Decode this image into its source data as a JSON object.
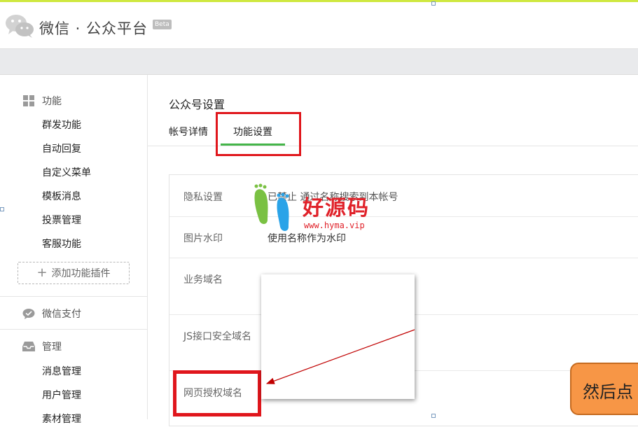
{
  "header": {
    "title": "微信 · 公众平台",
    "beta": "Beta"
  },
  "sidebar": {
    "sections": [
      {
        "label": "功能",
        "icon": "grid-icon"
      },
      {
        "label": "微信支付",
        "icon": "wechat-pay-icon"
      },
      {
        "label": "管理",
        "icon": "inbox-icon"
      }
    ],
    "function_items": [
      "群发功能",
      "自动回复",
      "自定义菜单",
      "模板消息",
      "投票管理",
      "客服功能"
    ],
    "add_plugin": "添加功能插件",
    "manage_items": [
      "消息管理",
      "用户管理",
      "素材管理"
    ]
  },
  "main": {
    "page_title": "公众号设置",
    "tabs": [
      {
        "label": "帐号详情",
        "active": false
      },
      {
        "label": "功能设置",
        "active": true
      }
    ],
    "settings": [
      {
        "label": "隐私设置",
        "value": "已禁止 通过名称搜索到本帐号"
      },
      {
        "label": "图片水印",
        "value": "使用名称作为水印"
      },
      {
        "label": "业务域名",
        "value": ""
      },
      {
        "label": "JS接口安全域名",
        "value": ""
      },
      {
        "label": "网页授权域名",
        "value": ""
      }
    ]
  },
  "overlay": {
    "callout_text": "然后点",
    "watermark_text": "好源码",
    "watermark_url": "www.hyma.vip"
  },
  "colors": {
    "accent_green": "#44b549",
    "highlight_red": "#e0161c",
    "callout_orange": "#f79646",
    "top_bar": "#cfe840"
  }
}
